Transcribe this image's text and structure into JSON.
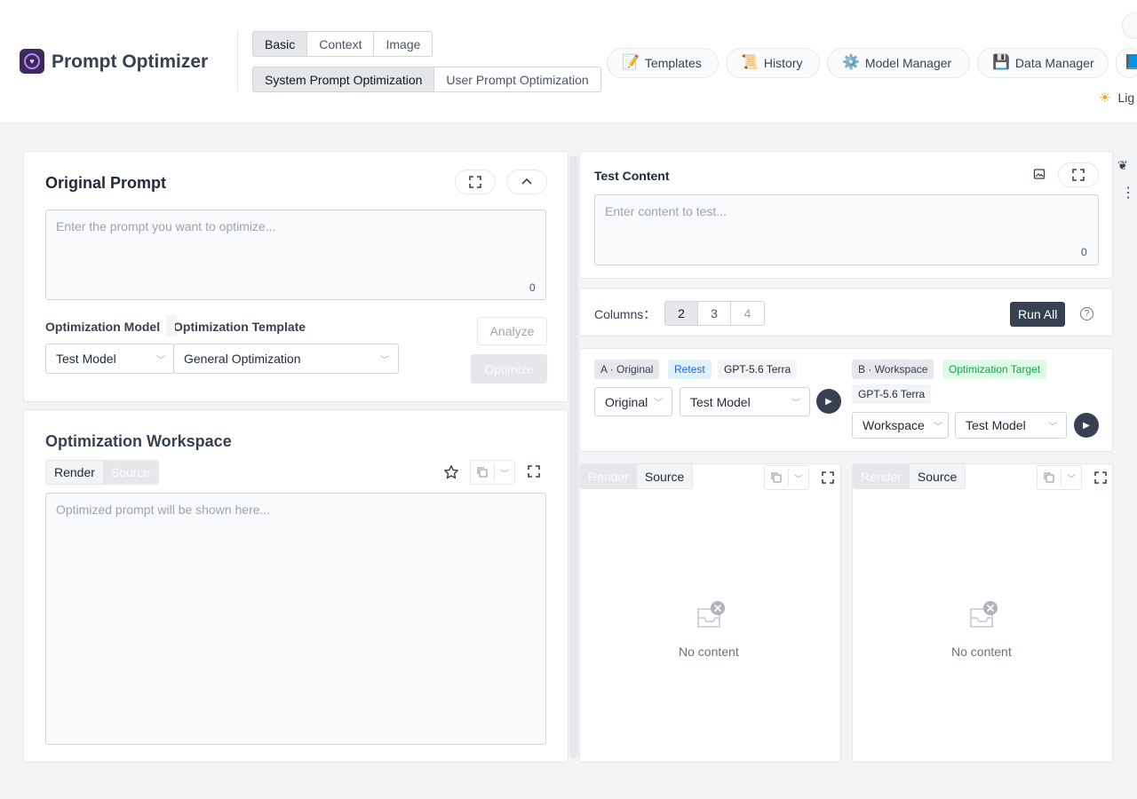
{
  "header": {
    "app_title": "Prompt Optimizer",
    "mode_tabs": [
      "Basic",
      "Context",
      "Image"
    ],
    "function_tabs": [
      "System Prompt Optimization",
      "User Prompt Optimization"
    ],
    "nav": {
      "templates": "Templates",
      "history": "History",
      "model_manager": "Model Manager",
      "data_manager": "Data Manager"
    },
    "theme_label": "Lig"
  },
  "original_prompt": {
    "title": "Original Prompt",
    "placeholder": "Enter the prompt you want to optimize...",
    "char_count": "0",
    "optimization_model_label": "Optimization Model",
    "optimization_model_value": "Test Model",
    "optimization_template_label": "Optimization Template",
    "optimization_template_value": "General Optimization",
    "analyze_label": "Analyze",
    "optimize_label": "Optimize"
  },
  "workspace": {
    "title": "Optimization Workspace",
    "tab_render": "Render",
    "tab_source": "Source",
    "placeholder": "Optimized prompt will be shown here..."
  },
  "test_content": {
    "title": "Test Content",
    "placeholder": "Enter content to test...",
    "char_count": "0"
  },
  "columns": {
    "label": "Columns：",
    "options": [
      "2",
      "3",
      "4"
    ],
    "run_all_label": "Run All"
  },
  "variant_a": {
    "label": "A · Original",
    "tag_retest": "Retest",
    "model_tag": "GPT-5.6 Terra",
    "source_select": "Original",
    "model_select": "Test Model"
  },
  "variant_b": {
    "label": "B · Workspace",
    "tag_target": "Optimization Target",
    "model_tag": "GPT-5.6 Terra",
    "source_select": "Workspace",
    "model_select": "Test Model"
  },
  "result_a": {
    "tab_render": "Render",
    "tab_source": "Source",
    "empty_text": "No content"
  },
  "result_b": {
    "tab_render": "Render",
    "tab_source": "Source",
    "empty_text": "No content"
  }
}
